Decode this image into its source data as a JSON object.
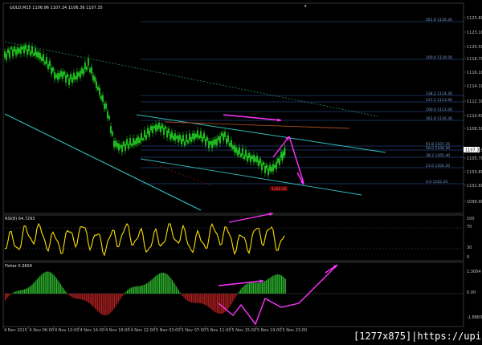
{
  "window": {
    "symbol_header": "GOLD,M15  1106.96 1107.24 1106.36 1107.35"
  },
  "main_panel": {
    "price_axis": [
      "1125.80",
      "1123.10",
      "1120.50",
      "1118.70",
      "1116.10",
      "1114.10",
      "1112.30",
      "1110.60",
      "1108.50",
      "1107.35",
      "1105.70",
      "1103.80",
      "1101.80",
      "1099.90"
    ],
    "current_price": "1107.35",
    "fib_levels": [
      "261.8 1126.20",
      "100.0 1111.00",
      "61.8 1107.25",
      "50.0 1106.40",
      "38.2 1105.40",
      "23.6 1104.20",
      "0.0 1102.20",
      "161.8 1116.30",
      "138.2 1114.30",
      "127.2 1113.90",
      "200.0 1119.56"
    ],
    "stop_label": "1102.20"
  },
  "rsi_panel": {
    "header": "RSI(8) 64.7293",
    "levels": [
      "100",
      "70",
      "30",
      "0"
    ]
  },
  "fisher_panel": {
    "header": "Fisher 0.3604",
    "levels": [
      "1.3004",
      "0.00",
      "-1.8883"
    ]
  },
  "time_axis": [
    "4 Nov 2015",
    "4 Nov 06:00",
    "4 Nov 10:00",
    "4 Nov 14:00",
    "4 Nov 18:00",
    "4 Nov 22:00",
    "5 Nov 03:00",
    "5 Nov 07:00",
    "5 Nov 11:00",
    "5 Nov 15:00",
    "5 Nov 19:00",
    "5 Nov 23:00"
  ],
  "watermark": "[1277x875]|https://upic.me/",
  "colors": {
    "candle": "#22cc22",
    "rsi": "#ffe000",
    "fisher_up": "#2db82d",
    "fisher_down": "#b32020",
    "annotation": "#ff33ff",
    "channel": "#33bbbb",
    "fib": "#2f5fb0"
  }
}
